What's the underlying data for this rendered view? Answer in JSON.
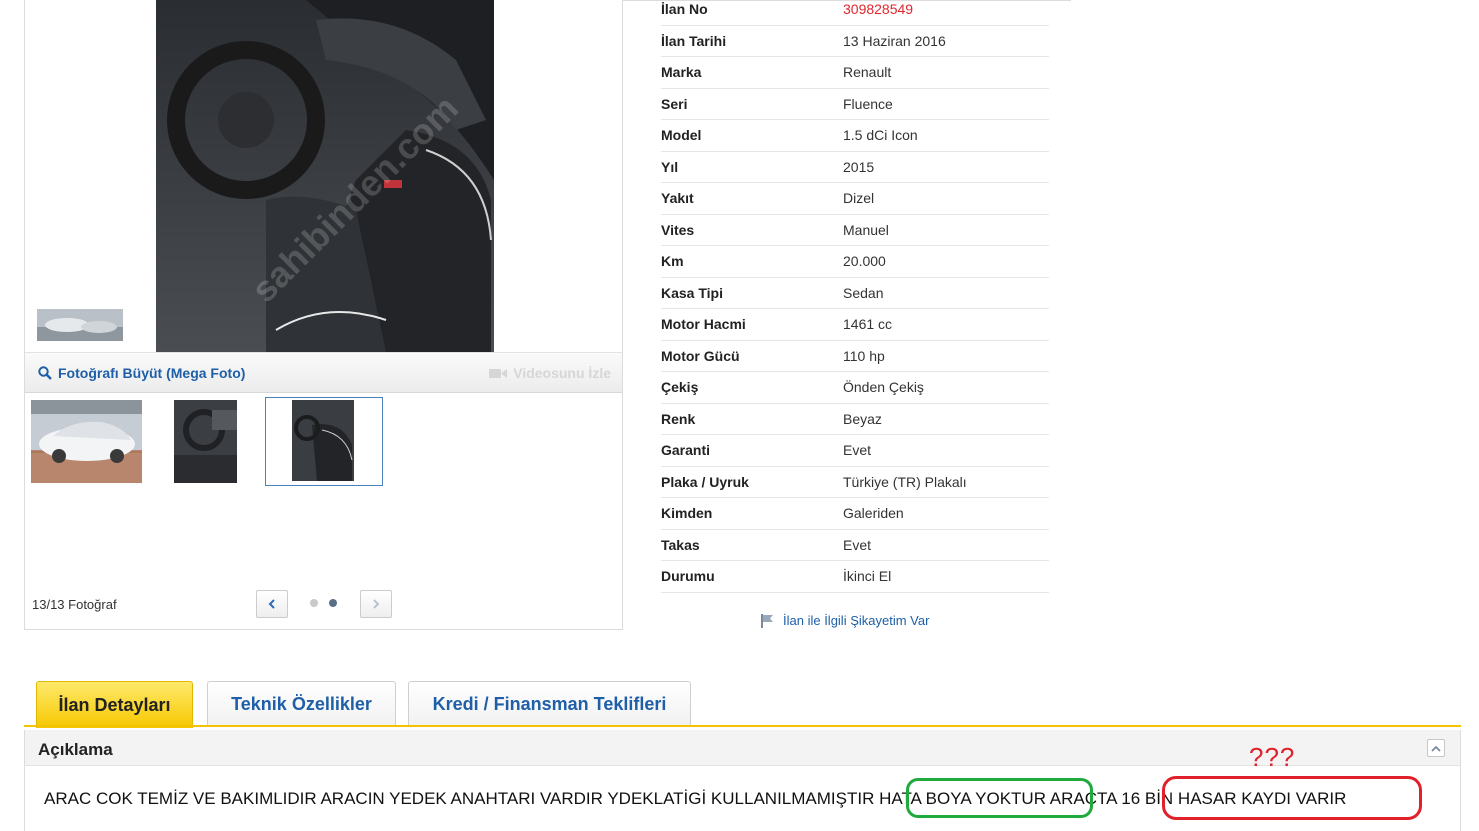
{
  "gallery": {
    "mega_photo_label": "Fotoğrafı Büyüt (Mega Foto)",
    "video_label": "Videosunu İzle",
    "photo_count": "13/13 Fotoğraf",
    "watermark": "sahibinden.com"
  },
  "details": [
    {
      "key": "İlan No",
      "value": "309828549"
    },
    {
      "key": "İlan Tarihi",
      "value": "13 Haziran 2016"
    },
    {
      "key": "Marka",
      "value": "Renault"
    },
    {
      "key": "Seri",
      "value": "Fluence"
    },
    {
      "key": "Model",
      "value": "1.5 dCi Icon"
    },
    {
      "key": "Yıl",
      "value": "2015"
    },
    {
      "key": "Yakıt",
      "value": "Dizel"
    },
    {
      "key": "Vites",
      "value": "Manuel"
    },
    {
      "key": "Km",
      "value": "20.000"
    },
    {
      "key": "Kasa Tipi",
      "value": "Sedan"
    },
    {
      "key": "Motor Hacmi",
      "value": "1461 cc"
    },
    {
      "key": "Motor Gücü",
      "value": "110 hp"
    },
    {
      "key": "Çekiş",
      "value": "Önden Çekiş"
    },
    {
      "key": "Renk",
      "value": "Beyaz"
    },
    {
      "key": "Garanti",
      "value": "Evet"
    },
    {
      "key": "Plaka / Uyruk",
      "value": "Türkiye (TR) Plakalı"
    },
    {
      "key": "Kimden",
      "value": "Galeriden"
    },
    {
      "key": "Takas",
      "value": "Evet"
    },
    {
      "key": "Durumu",
      "value": "İkinci El"
    }
  ],
  "complaint_label": "İlan ile İlgili Şikayetim Var",
  "tabs": [
    {
      "label": "İlan Detayları"
    },
    {
      "label": "Teknik Özellikler"
    },
    {
      "label": "Kredi / Finansman Teklifleri"
    }
  ],
  "description": {
    "title": "Açıklama",
    "text": "ARAC COK TEMİZ VE BAKIMLIDIR ARACIN YEDEK ANAHTARI VARDIR YDEKLATİGİ KULLANILMAMIŞTIR HATA BOYA YOKTUR ARACTA 16 BİN HASAR KAYDI VARIR"
  },
  "annotation": {
    "question": "???"
  },
  "colors": {
    "link_blue": "#1e5fa8",
    "tab_yellow": "#f6c800",
    "listing_no_red": "#e0272e",
    "annotation_green": "#1eaa3c",
    "annotation_red": "#e0202a"
  }
}
